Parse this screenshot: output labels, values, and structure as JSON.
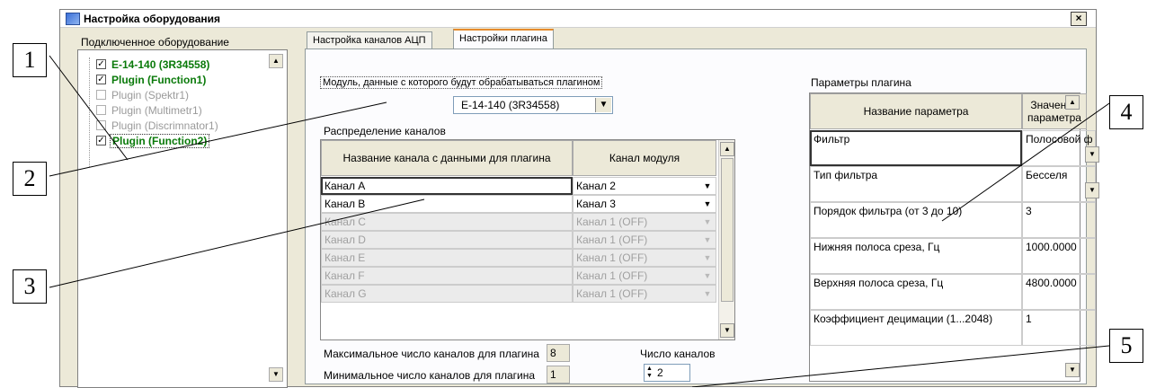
{
  "window": {
    "title": "Настройка оборудования",
    "close_label": "×"
  },
  "left_panel": {
    "label": "Подключенное оборудование",
    "items": [
      {
        "label": "E-14-140 (3R34558)",
        "checked": true,
        "state": "on"
      },
      {
        "label": "Plugin (Function1)",
        "checked": true,
        "state": "on"
      },
      {
        "label": "Plugin (Spektr1)",
        "checked": false,
        "state": "off"
      },
      {
        "label": "Plugin (Multimetr1)",
        "checked": false,
        "state": "off"
      },
      {
        "label": "Plugin (Discrimnator1)",
        "checked": false,
        "state": "off"
      },
      {
        "label": "Plugin (Function2)",
        "checked": true,
        "state": "on",
        "selected": true
      }
    ],
    "check_mark": "✓"
  },
  "tabs": [
    {
      "label": "Настройка каналов АЦП",
      "active": false
    },
    {
      "label": "Настройки плагина",
      "active": true
    }
  ],
  "plugin_tab": {
    "module_label": "Модуль, данные с которого будут обрабатываться плагином",
    "module_value": "E-14-140 (3R34558)",
    "channels_label": "Распределение каналов",
    "grid_headers": [
      "Название канала с данными для плагина",
      "Канал модуля"
    ],
    "channel_rows": [
      {
        "name": "Канал A",
        "module": "Канал 2",
        "enabled": true
      },
      {
        "name": "Канал B",
        "module": "Канал 3",
        "enabled": true
      },
      {
        "name": "Канал C",
        "module": "Канал 1 (OFF)",
        "enabled": false
      },
      {
        "name": "Канал D",
        "module": "Канал 1 (OFF)",
        "enabled": false
      },
      {
        "name": "Канал E",
        "module": "Канал 1 (OFF)",
        "enabled": false
      },
      {
        "name": "Канал F",
        "module": "Канал 1 (OFF)",
        "enabled": false
      },
      {
        "name": "Канал G",
        "module": "Канал 1 (OFF)",
        "enabled": false
      }
    ],
    "max_label": "Максимальное число каналов для плагина",
    "max_value": "8",
    "min_label": "Минимальное число каналов для плагина",
    "min_value": "1",
    "count_label": "Число каналов",
    "count_value": "2",
    "params_label": "Параметры плагина",
    "param_headers": [
      "Название параметра",
      "Значение параметра"
    ],
    "params": [
      {
        "name": "Фильтр",
        "value": "Полосовой ф",
        "dropdown": true
      },
      {
        "name": "Тип фильтра",
        "value": "Бесселя",
        "dropdown": true
      },
      {
        "name": "Порядок фильтра (от 3 до 10)",
        "value": "3",
        "dropdown": false
      },
      {
        "name": "Нижняя полоса среза, Гц",
        "value": "1000.0000",
        "dropdown": false
      },
      {
        "name": "Верхняя полоса среза, Гц",
        "value": "4800.0000",
        "dropdown": false
      },
      {
        "name": "Коэффициент децимации (1...2048)",
        "value": "1",
        "dropdown": false
      }
    ]
  },
  "callouts": [
    "1",
    "2",
    "3",
    "4",
    "5"
  ],
  "icons": {
    "dropdown": "▼",
    "scroll_up": "▲",
    "scroll_down": "▼"
  },
  "colors": {
    "enabled_plugin": "#0a7a0a",
    "disabled_plugin": "#9a9a9a",
    "active_tab_accent": "#e68b2c",
    "window_bg": "#ece9d8"
  }
}
